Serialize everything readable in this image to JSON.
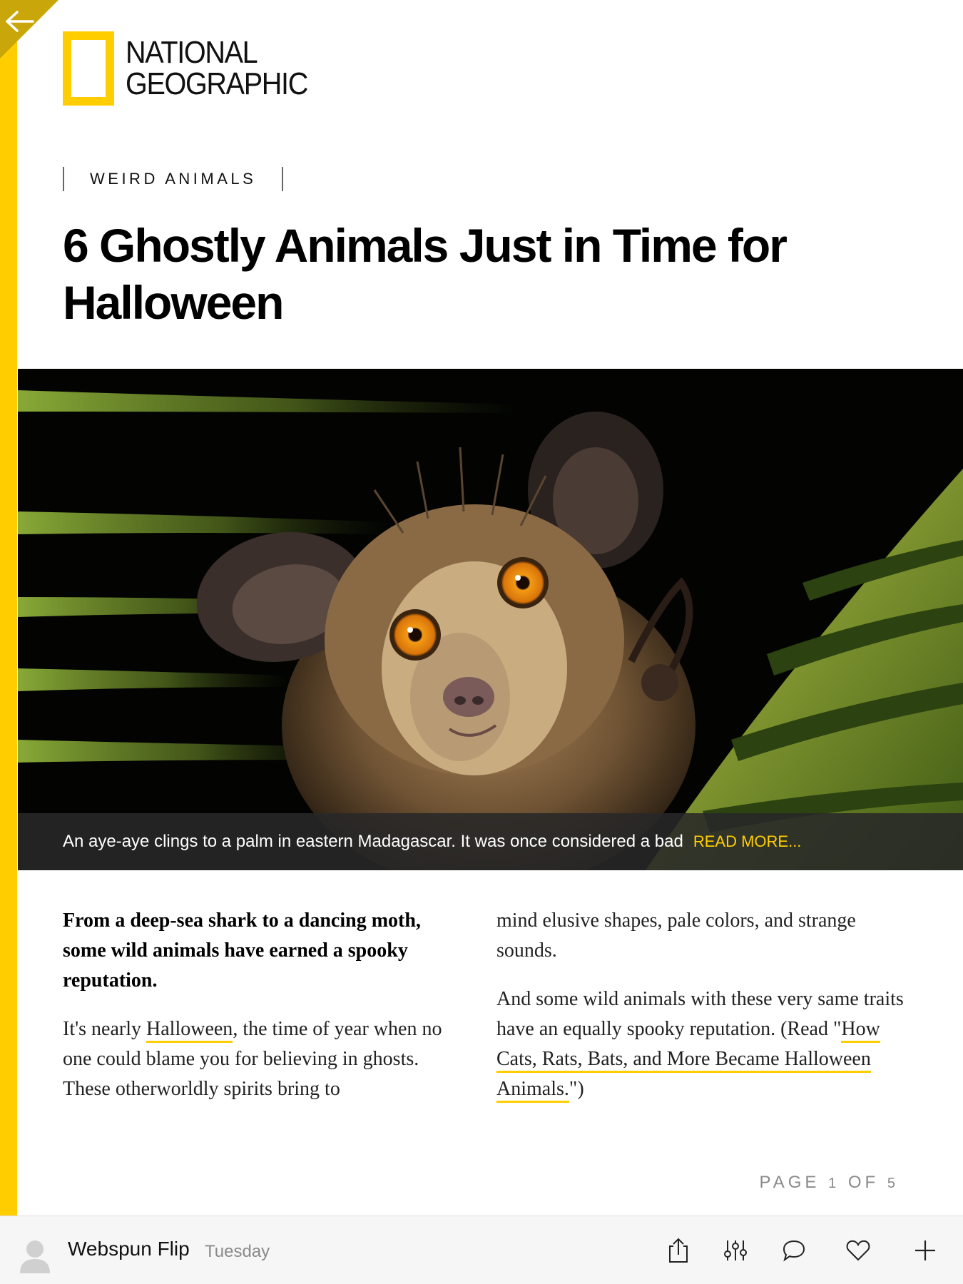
{
  "brand": {
    "name_line1": "NATIONAL",
    "name_line2": "GEOGRAPHIC",
    "accent_color": "#FFCD00"
  },
  "navigation": {
    "back_icon": "back-arrow-icon"
  },
  "article": {
    "kicker": "WEIRD ANIMALS",
    "headline": "6 Ghostly Animals Just in Time for Halloween",
    "hero": {
      "caption": "An aye-aye clings to a palm in eastern Madagascar. It was once considered a bad",
      "read_more": "READ MORE..."
    },
    "dek": "From a deep-sea shark to a dancing moth, some wild animals have earned a spooky reputation.",
    "para1_before": "It's nearly ",
    "para1_link": "Halloween",
    "para1_after": ", the time of year when no one could blame you for believing in ghosts. These otherworldly spirits bring to",
    "para1_cont": "mind elusive shapes, pale colors, and strange sounds.",
    "para2_before": "And some wild animals with these very same traits have an equally spooky reputation. (Read \"",
    "para2_link": "How Cats, Rats, Bats, and More Became Halloween Animals.",
    "para2_after": "\")"
  },
  "pager": {
    "label": "PAGE",
    "current": "1",
    "of": "OF",
    "total": "5"
  },
  "footer": {
    "author": "Webspun Flip",
    "date": "Tuesday",
    "actions": [
      "share-icon",
      "tune-icon",
      "comment-icon",
      "heart-icon",
      "plus-icon"
    ]
  }
}
